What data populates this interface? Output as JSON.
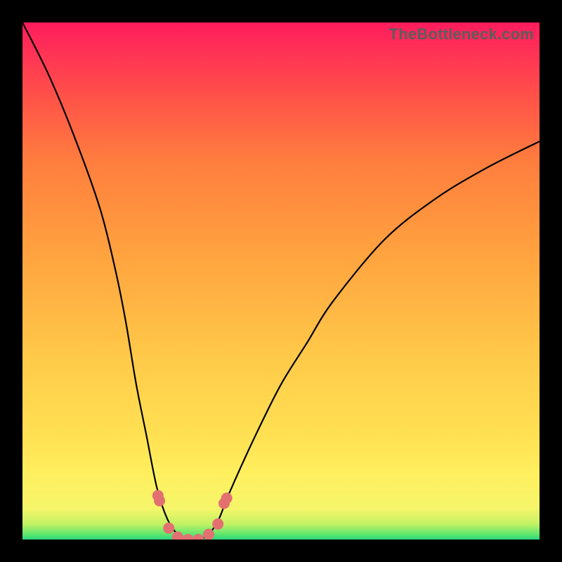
{
  "watermark": "TheBottleneck.com",
  "chart_data": {
    "type": "line",
    "title": "",
    "xlabel": "",
    "ylabel": "",
    "x_range": [
      0,
      1
    ],
    "y_range": [
      0,
      1
    ],
    "series": [
      {
        "name": "bottleneck-curve",
        "xy": [
          [
            0.0,
            1.0
          ],
          [
            0.05,
            0.9
          ],
          [
            0.1,
            0.78
          ],
          [
            0.15,
            0.64
          ],
          [
            0.18,
            0.52
          ],
          [
            0.2,
            0.42
          ],
          [
            0.22,
            0.3
          ],
          [
            0.24,
            0.2
          ],
          [
            0.26,
            0.1
          ],
          [
            0.28,
            0.04
          ],
          [
            0.3,
            0.01
          ],
          [
            0.32,
            0.0
          ],
          [
            0.34,
            0.0
          ],
          [
            0.36,
            0.01
          ],
          [
            0.38,
            0.04
          ],
          [
            0.4,
            0.09
          ],
          [
            0.45,
            0.2
          ],
          [
            0.5,
            0.3
          ],
          [
            0.55,
            0.38
          ],
          [
            0.6,
            0.46
          ],
          [
            0.7,
            0.58
          ],
          [
            0.8,
            0.66
          ],
          [
            0.9,
            0.72
          ],
          [
            1.0,
            0.77
          ]
        ]
      }
    ],
    "markers": [
      {
        "x": 0.262,
        "y": 0.085
      },
      {
        "x": 0.265,
        "y": 0.075
      },
      {
        "x": 0.283,
        "y": 0.022
      },
      {
        "x": 0.3,
        "y": 0.005
      },
      {
        "x": 0.32,
        "y": 0.0
      },
      {
        "x": 0.34,
        "y": 0.0
      },
      {
        "x": 0.36,
        "y": 0.01
      },
      {
        "x": 0.378,
        "y": 0.03
      },
      {
        "x": 0.39,
        "y": 0.07
      },
      {
        "x": 0.395,
        "y": 0.08
      }
    ],
    "gradient_stops": [
      {
        "pos": 0.0,
        "color": "#2cd57d"
      },
      {
        "pos": 0.01,
        "color": "#5de66f"
      },
      {
        "pos": 0.03,
        "color": "#c3f263"
      },
      {
        "pos": 0.06,
        "color": "#f6f56a"
      },
      {
        "pos": 0.13,
        "color": "#ffef5e"
      },
      {
        "pos": 0.2,
        "color": "#ffe153"
      },
      {
        "pos": 0.35,
        "color": "#ffca49"
      },
      {
        "pos": 0.55,
        "color": "#ffa33f"
      },
      {
        "pos": 0.73,
        "color": "#ff7e3e"
      },
      {
        "pos": 0.85,
        "color": "#ff5448"
      },
      {
        "pos": 0.95,
        "color": "#ff2f56"
      },
      {
        "pos": 1.0,
        "color": "#ff1c5d"
      }
    ]
  }
}
